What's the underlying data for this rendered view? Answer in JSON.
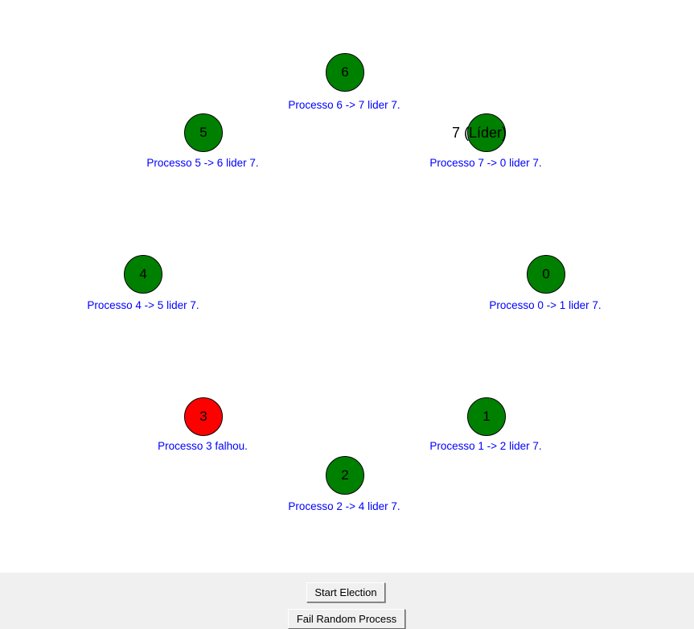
{
  "colors": {
    "active_node": "#008000",
    "failed_node": "#ff0000",
    "status_text": "#0000ff"
  },
  "nodes": {
    "n0": {
      "label": "0",
      "status": "Processo 0 -> 1 lider 7.",
      "state": "active"
    },
    "n1": {
      "label": "1",
      "status": "Processo 1 -> 2 lider 7.",
      "state": "active"
    },
    "n2": {
      "label": "2",
      "status": "Processo 2 -> 4 lider 7.",
      "state": "active"
    },
    "n3": {
      "label": "3",
      "status": "Processo 3 falhou.",
      "state": "failed"
    },
    "n4": {
      "label": "4",
      "status": "Processo 4 -> 5 lider 7.",
      "state": "active"
    },
    "n5": {
      "label": "5",
      "status": "Processo 5 -> 6 lider 7.",
      "state": "active"
    },
    "n6": {
      "label": "6",
      "status": "Processo 6 -> 7 lider 7.",
      "state": "active"
    },
    "n7": {
      "label": "7 (Líder)",
      "status": "Processo 7 -> 0 lider 7.",
      "state": "active"
    }
  },
  "buttons": {
    "start_election": "Start Election",
    "fail_random": "Fail Random Process"
  }
}
